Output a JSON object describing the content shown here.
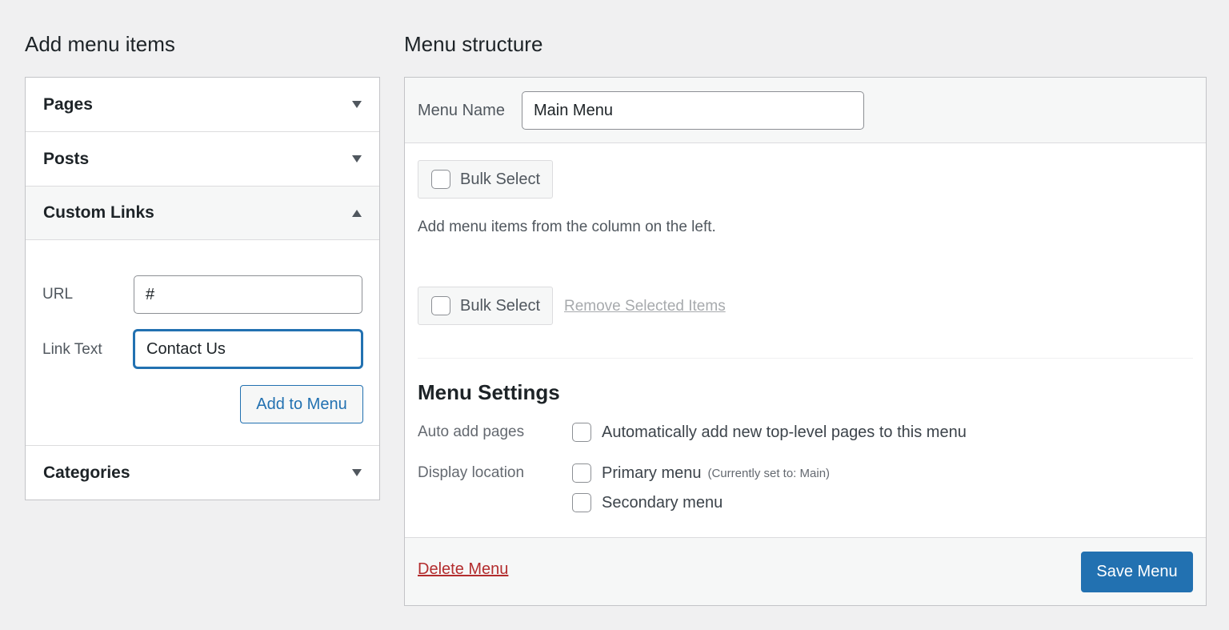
{
  "left": {
    "heading": "Add menu items",
    "sections": [
      {
        "title": "Pages",
        "state": "collapsed"
      },
      {
        "title": "Posts",
        "state": "collapsed"
      },
      {
        "title": "Custom Links",
        "state": "expanded"
      },
      {
        "title": "Categories",
        "state": "collapsed"
      }
    ],
    "custom_links": {
      "url_label": "URL",
      "url_value": "#",
      "link_text_label": "Link Text",
      "link_text_value": "Contact Us",
      "add_button": "Add to Menu"
    }
  },
  "right": {
    "heading": "Menu structure",
    "menu_name_label": "Menu Name",
    "menu_name_value": "Main Menu",
    "bulk_select": "Bulk Select",
    "help_text": "Add menu items from the column on the left.",
    "remove_selected": "Remove Selected Items",
    "settings": {
      "title": "Menu Settings",
      "auto_add_label": "Auto add pages",
      "auto_add_option": "Automatically add new top-level pages to this menu",
      "display_location_label": "Display location",
      "primary_option": "Primary menu",
      "primary_note": "(Currently set to: Main)",
      "secondary_option": "Secondary menu"
    },
    "delete_menu": "Delete Menu",
    "save_menu": "Save Menu"
  },
  "colors": {
    "accent": "#2271b1",
    "danger": "#b32d2e",
    "background": "#f0f0f1"
  }
}
